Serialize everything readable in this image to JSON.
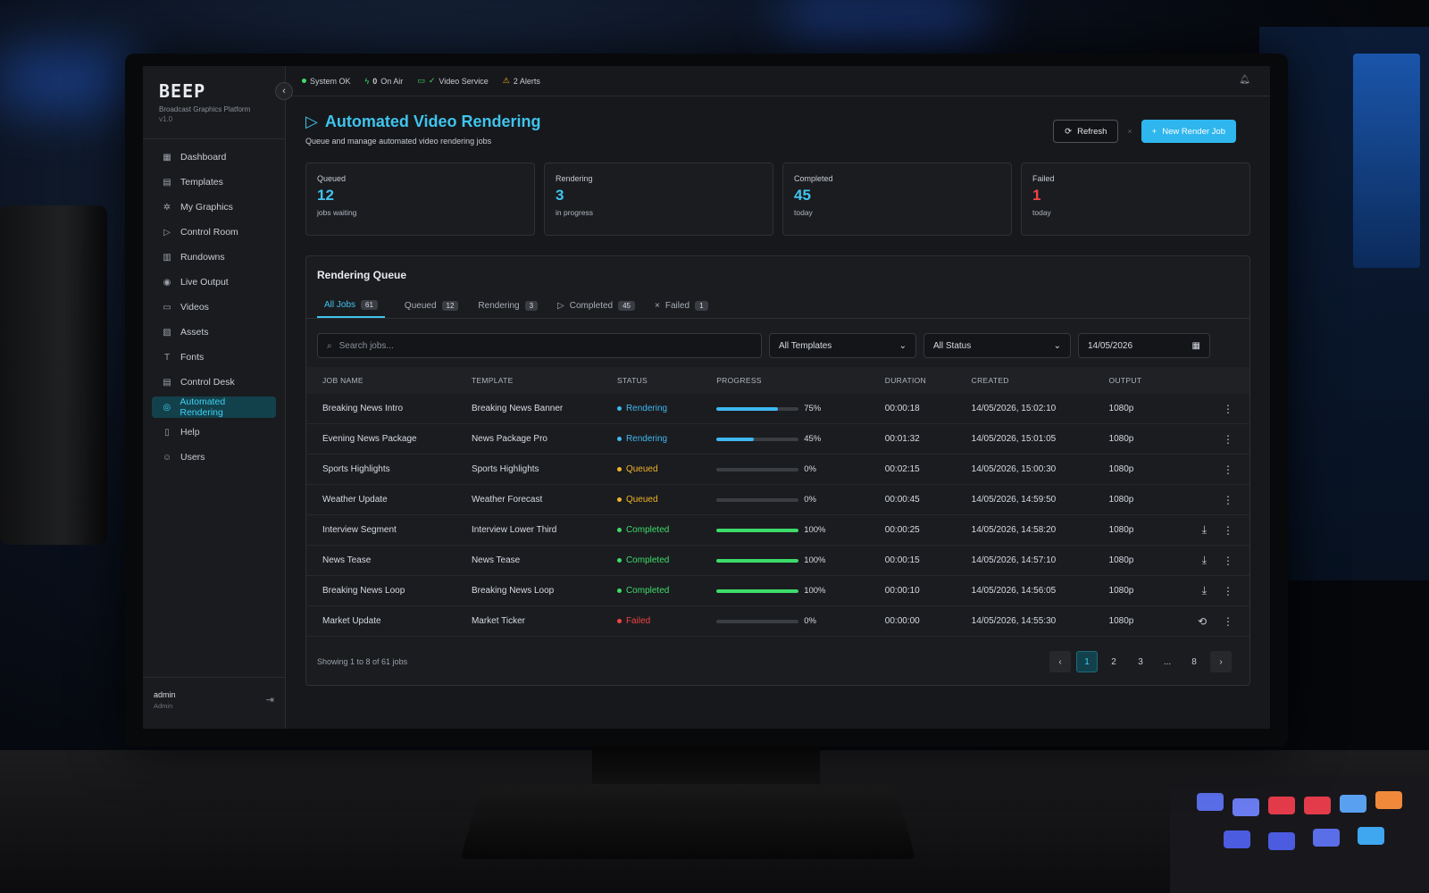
{
  "brand": {
    "logo": "BEEP",
    "subtitle": "Broadcast Graphics Platform",
    "version": "v1.0"
  },
  "sidebar": {
    "items": [
      {
        "label": "Dashboard",
        "icon": "grid-icon"
      },
      {
        "label": "Templates",
        "icon": "file-icon"
      },
      {
        "label": "My Graphics",
        "icon": "sparkle-icon"
      },
      {
        "label": "Control Room",
        "icon": "play-icon"
      },
      {
        "label": "Rundowns",
        "icon": "table-icon"
      },
      {
        "label": "Live Output",
        "icon": "broadcast-icon"
      },
      {
        "label": "Videos",
        "icon": "video-icon"
      },
      {
        "label": "Assets",
        "icon": "image-icon"
      },
      {
        "label": "Fonts",
        "icon": "type-icon"
      },
      {
        "label": "Control Desk",
        "icon": "keyboard-icon"
      },
      {
        "label": "Automated Rendering",
        "icon": "render-icon",
        "active": true
      },
      {
        "label": "Help",
        "icon": "book-icon"
      },
      {
        "label": "Users",
        "icon": "users-icon"
      }
    ],
    "user": {
      "name": "admin",
      "role": "Admin"
    }
  },
  "statusbar": {
    "system": "System OK",
    "on_air_count": "0",
    "on_air_label": "On Air",
    "video_service": "Video Service",
    "alerts": "2 Alerts"
  },
  "page": {
    "title": "Automated Video Rendering",
    "subtitle": "Queue and manage automated video rendering jobs",
    "refresh_label": "Refresh",
    "new_job_label": "New Render Job"
  },
  "stats": [
    {
      "label": "Queued",
      "value": "12",
      "note": "jobs waiting",
      "color": "#3fc4ee"
    },
    {
      "label": "Rendering",
      "value": "3",
      "note": "in progress",
      "color": "#3fc4ee"
    },
    {
      "label": "Completed",
      "value": "45",
      "note": "today",
      "color": "#3fc4ee"
    },
    {
      "label": "Failed",
      "value": "1",
      "note": "today",
      "color": "#ef4444"
    }
  ],
  "queue": {
    "title": "Rendering Queue",
    "tabs": [
      {
        "label": "All Jobs",
        "count": "61"
      },
      {
        "label": "Queued",
        "count": "12"
      },
      {
        "label": "Rendering",
        "count": "3"
      },
      {
        "label": "Completed",
        "count": "45"
      },
      {
        "label": "Failed",
        "count": "1"
      }
    ],
    "search_placeholder": "Search jobs...",
    "template_filter": "All Templates",
    "status_filter": "All Status",
    "date_filter": "14/05/2026",
    "columns": [
      "JOB NAME",
      "TEMPLATE",
      "STATUS",
      "PROGRESS",
      "DURATION",
      "CREATED",
      "OUTPUT"
    ],
    "rows": [
      {
        "job": "Breaking News Intro",
        "template": "Breaking News Banner",
        "status": "Rendering",
        "progress": 75,
        "duration": "00:00:18",
        "created": "14/05/2026, 15:02:10",
        "output": "1080p",
        "action": ""
      },
      {
        "job": "Evening News Package",
        "template": "News Package Pro",
        "status": "Rendering",
        "progress": 45,
        "duration": "00:01:32",
        "created": "14/05/2026, 15:01:05",
        "output": "1080p",
        "action": ""
      },
      {
        "job": "Sports Highlights",
        "template": "Sports Highlights",
        "status": "Queued",
        "progress": 0,
        "duration": "00:02:15",
        "created": "14/05/2026, 15:00:30",
        "output": "1080p",
        "action": ""
      },
      {
        "job": "Weather Update",
        "template": "Weather Forecast",
        "status": "Queued",
        "progress": 0,
        "duration": "00:00:45",
        "created": "14/05/2026, 14:59:50",
        "output": "1080p",
        "action": ""
      },
      {
        "job": "Interview Segment",
        "template": "Interview Lower Third",
        "status": "Completed",
        "progress": 100,
        "duration": "00:00:25",
        "created": "14/05/2026, 14:58:20",
        "output": "1080p",
        "action": "download"
      },
      {
        "job": "News Tease",
        "template": "News Tease",
        "status": "Completed",
        "progress": 100,
        "duration": "00:00:15",
        "created": "14/05/2026, 14:57:10",
        "output": "1080p",
        "action": "download"
      },
      {
        "job": "Breaking News Loop",
        "template": "Breaking News Loop",
        "status": "Completed",
        "progress": 100,
        "duration": "00:00:10",
        "created": "14/05/2026, 14:56:05",
        "output": "1080p",
        "action": "download"
      },
      {
        "job": "Market Update",
        "template": "Market Ticker",
        "status": "Failed",
        "progress": 0,
        "duration": "00:00:00",
        "created": "14/05/2026, 14:55:30",
        "output": "1080p",
        "action": "retry"
      }
    ],
    "pagination_info": "Showing 1 to 8 of 61 jobs",
    "pages": [
      "1",
      "2",
      "3",
      "...",
      "8"
    ]
  },
  "colors": {
    "accent": "#3fc4ee",
    "rendering": "#3fb8f0",
    "queued": "#f0b429",
    "completed": "#3ddc6a",
    "failed": "#ef4444"
  }
}
